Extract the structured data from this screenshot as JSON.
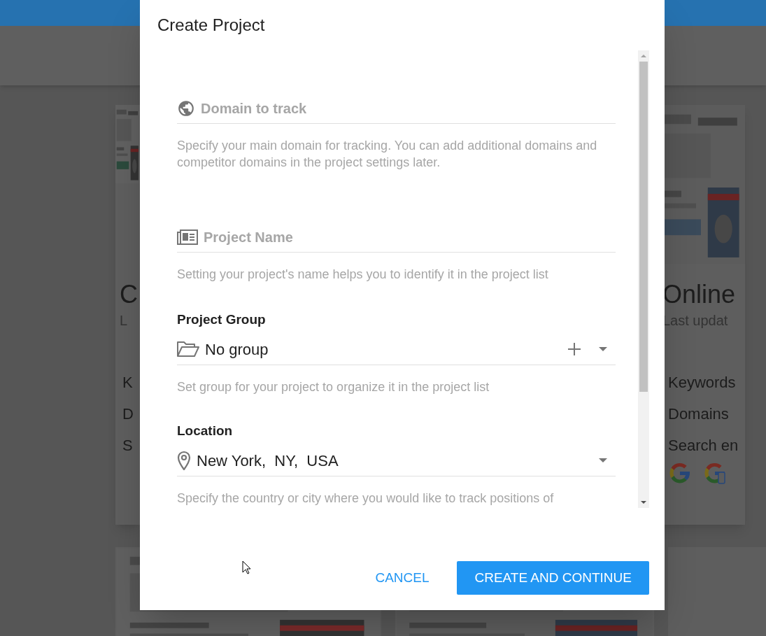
{
  "background_cards": [
    {
      "kind": "cut",
      "title": "C",
      "subtitle": "L",
      "stats": [
        "K",
        "D",
        "S"
      ]
    },
    {
      "kind": "full",
      "title": "Online",
      "subtitle": "Last updat",
      "stats": [
        "Keywords",
        "Domains",
        "Search en"
      ]
    }
  ],
  "dialog": {
    "title": "Create Project",
    "fields": [
      {
        "kind": "text",
        "placeholder": "Domain to track",
        "help": "Specify your main domain for tracking. You can add additional domains and competitor domains in the project settings later."
      },
      {
        "kind": "text",
        "placeholder": "Project Name",
        "help": "Setting your project's name helps you to identify it in the project list"
      },
      {
        "kind": "select",
        "label": "Project Group",
        "value": "No group",
        "addable": true,
        "help": "Set group for your project to organize it in the project list"
      },
      {
        "kind": "select",
        "label": "Location",
        "value": "New York,  NY,  USA",
        "addable": false,
        "help": "Specify the country or city where you would like to track positions of"
      }
    ],
    "buttons": [
      {
        "kind": "text",
        "label": "CANCEL"
      },
      {
        "kind": "primary",
        "label": "CREATE AND CONTINUE"
      }
    ]
  }
}
